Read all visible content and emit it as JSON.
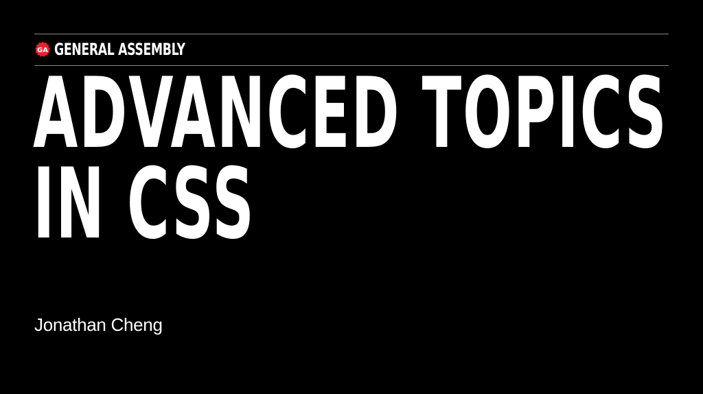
{
  "slide": {
    "background_color": "#000000",
    "rule_color": "#8a8a8a",
    "brand": {
      "logo_text": "GA",
      "logo_color": "#e8222e",
      "logo_icon": "ga-seal-icon",
      "name": "GENERAL ASSEMBLY"
    },
    "title": {
      "line1": "ADVANCED TOPICS",
      "line2": "IN CSS"
    },
    "author": "Jonathan Cheng"
  }
}
